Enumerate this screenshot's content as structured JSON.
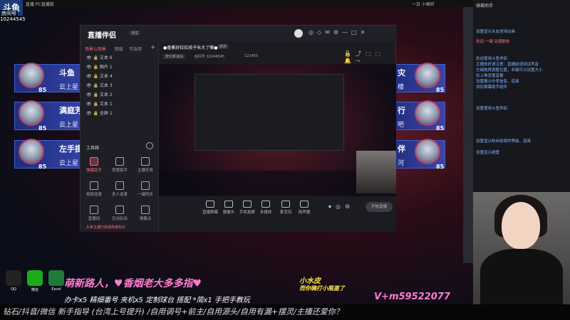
{
  "window": {
    "title": "直播 PC直播版",
    "corner_logo": "斗鱼",
    "viewer_badge": "房间号",
    "viewer_id": "10244545",
    "tray_label": "一日 小棉纤"
  },
  "player_cards": [
    {
      "name": "斗鱼",
      "sub": "云上星",
      "level": "85"
    },
    {
      "name": "满庭芳",
      "sub": "云上星",
      "level": "85"
    },
    {
      "name": "左手提",
      "sub": "云上星",
      "level": "85"
    }
  ],
  "right_cards": [
    {
      "name": "灾",
      "sub": "楼",
      "level": "85"
    },
    {
      "name": "行",
      "sub": "吧",
      "level": "85"
    },
    {
      "name": "伴",
      "sub": "河",
      "level": "85"
    }
  ],
  "app": {
    "logo": "直播伴侣",
    "badge": "测试",
    "stream_title": "●香蕉好拉拉孩子长大了嘛●",
    "edit_label": "修改",
    "category": "梦幻新诛仙",
    "room_info": "房间号 10244545",
    "fans": "121450",
    "tabs": [
      "场景1/场景",
      "图层",
      "可选项"
    ],
    "scenes": [
      "文本 6",
      "图片 1",
      "文本 4",
      "文本 3",
      "文本 2",
      "文本 1",
      "全屏 1"
    ],
    "tools_header": "工具箱",
    "tools": [
      {
        "label": "弹幕助手",
        "hot": true
      },
      {
        "label": "房管助手",
        "hot": false
      },
      {
        "label": "主播任务",
        "hot": false
      },
      {
        "label": "视频连麦",
        "hot": false
      },
      {
        "label": "多人连麦",
        "hot": false
      },
      {
        "label": "一键同步",
        "hot": false
      },
      {
        "label": "直播间",
        "hot": false
      },
      {
        "label": "互动玩法",
        "hot": false
      },
      {
        "label": "弹幕点",
        "hot": false
      }
    ],
    "footer_note": "头条主播已获得热度标识",
    "controls": [
      "直播屏幕",
      "摄像头",
      "手机投屏",
      "多媒体",
      "麦克风",
      "扬声器"
    ],
    "go_live": "开始直播"
  },
  "chat": [
    "设置显示水友进场动画",
    "欢迎 一键 动漫剧本",
    "欢迎使用斗鱼伴侣",
    "主播你好请注意：直播前请测试声音",
    "左键拖拽调整位置，右键可以设置大小",
    "右上角设置音量",
    "设置展示中奖信息、道具",
    "添加弹幕助手组件",
    "设置使用斗鱼伴侣",
    "设置显示粉丝勋章的等级、道具",
    "设置显示超管"
  ],
  "overlay": {
    "pink_top": "萌新路人，♥香烟老大多多指♥",
    "yellow_name": "小水皮",
    "yellow_sub": "而你确打小瓶盖了",
    "contact": "V+m59522077",
    "note_left": "办卡x5 精细番号 夹机x5 定制球台 搭配 *简x1 手把手教玩",
    "ticker": "钻石/抖音/微信 新手指导 (台湾上号提升) /自用调号+前主/自用源头/自用有漏+摆灵/主播还爱你？"
  },
  "dock": [
    {
      "label": "QQ"
    },
    {
      "label": "微信"
    },
    {
      "label": "Excel"
    }
  ]
}
